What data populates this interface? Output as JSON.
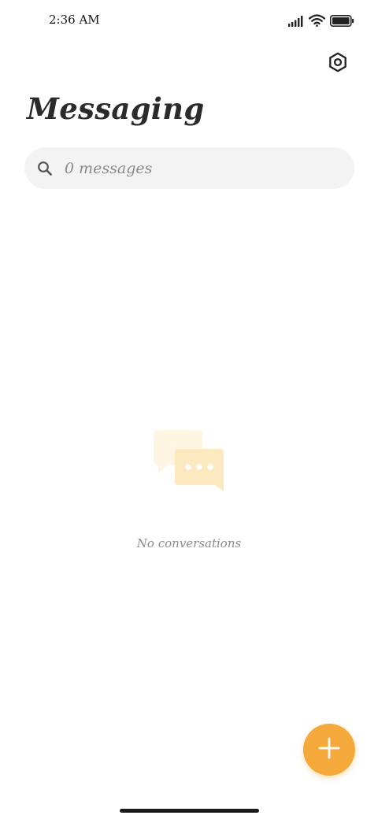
{
  "status_bar": {
    "time": "2:36 AM",
    "icons": [
      "signal-icon",
      "wifi-icon",
      "battery-icon"
    ]
  },
  "header": {
    "title": "Messaging",
    "settings_icon": "settings-icon"
  },
  "search": {
    "placeholder": "0 messages",
    "icon": "search-icon"
  },
  "empty_state": {
    "icon": "chat-bubbles-icon",
    "text": "No conversations"
  },
  "fab": {
    "icon": "plus-icon"
  },
  "colors": {
    "accent": "#f6a93b",
    "accent_light": "#fde9bf",
    "accent_lighter": "#fef6e3",
    "search_bg": "#f3f3f3",
    "muted_text": "#8a8a8a",
    "title_text": "#2b2b2b"
  }
}
